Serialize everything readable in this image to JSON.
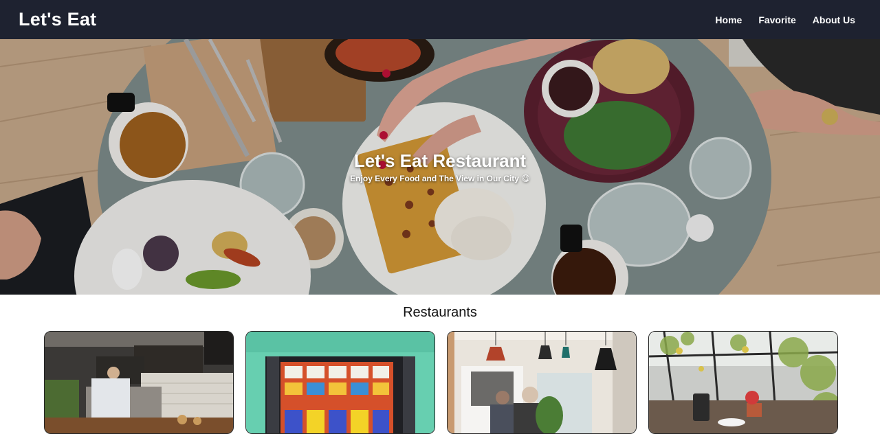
{
  "navbar": {
    "brand": "Let's Eat",
    "links": [
      "Home",
      "Favorite",
      "About Us"
    ]
  },
  "hero": {
    "title": "Let's Eat Restaurant",
    "subtitle": "Enjoy Every Food and The View in Our City 😋"
  },
  "restaurants": {
    "title": "Restaurants",
    "cards": [
      {
        "image": "kitchen-photo"
      },
      {
        "image": "storefront-photo"
      },
      {
        "image": "cafe-lamps-photo"
      },
      {
        "image": "garden-cafe-photo"
      }
    ]
  },
  "colors": {
    "navbar_bg": "#1e2230",
    "text_light": "#ffffff"
  }
}
